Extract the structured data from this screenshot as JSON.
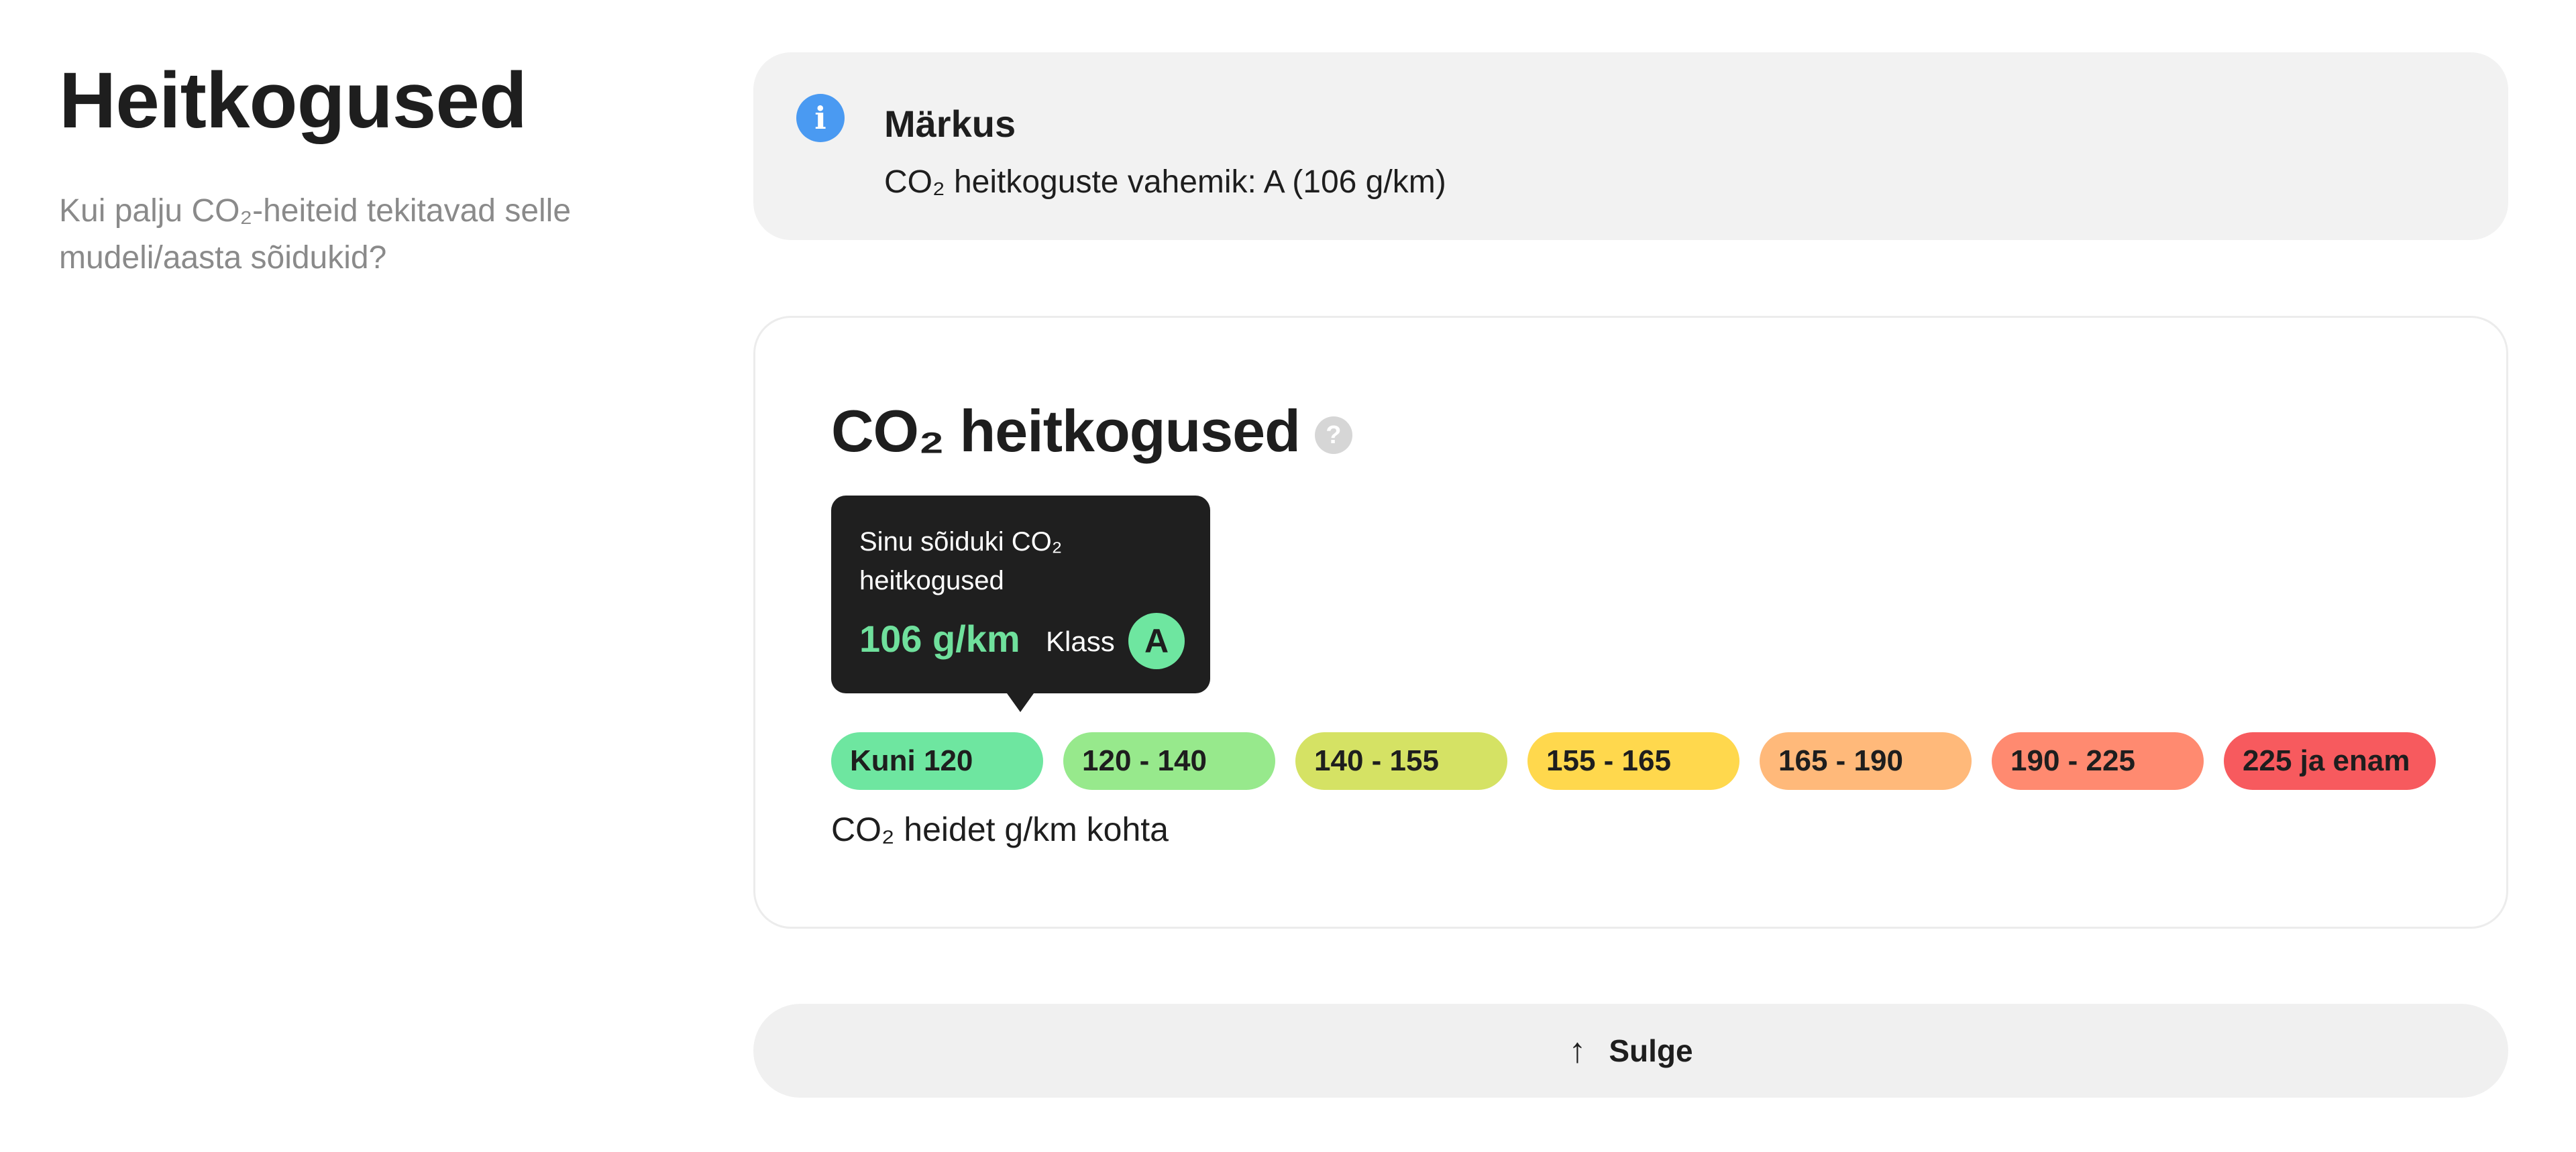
{
  "section": {
    "title": "Heitkogused",
    "description": "Kui palju CO₂-heiteid tekitavad selle mudeli/aasta sõidukid?"
  },
  "note": {
    "icon": "info-icon",
    "icon_glyph": "i",
    "title": "Märkus",
    "text": "CO₂ heitkoguste vahemik: A (106 g/km)"
  },
  "co2_card": {
    "title": "CO₂ heitkogused",
    "help_icon": "question-icon",
    "help_glyph": "?",
    "tooltip": {
      "label": "Sinu sõiduki CO₂ heitkogused",
      "value": "106 g/km",
      "class_label": "Klass",
      "class_value": "A",
      "value_color": "#6fe09c"
    },
    "ranges": [
      {
        "label": "Kuni 120",
        "color": "#6ee6a0"
      },
      {
        "label": "120 - 140",
        "color": "#97e98c"
      },
      {
        "label": "140 - 155",
        "color": "#d5e264"
      },
      {
        "label": "155 - 165",
        "color": "#ffd84d"
      },
      {
        "label": "165 - 190",
        "color": "#ffb97a"
      },
      {
        "label": "190 - 225",
        "color": "#ff8a70"
      },
      {
        "label": "225 ja enam",
        "color": "#f75a5e"
      }
    ],
    "caption": "CO₂ heidet g/km kohta"
  },
  "close_button": {
    "icon": "arrow-up-icon",
    "glyph": "↑",
    "label": "Sulge"
  }
}
